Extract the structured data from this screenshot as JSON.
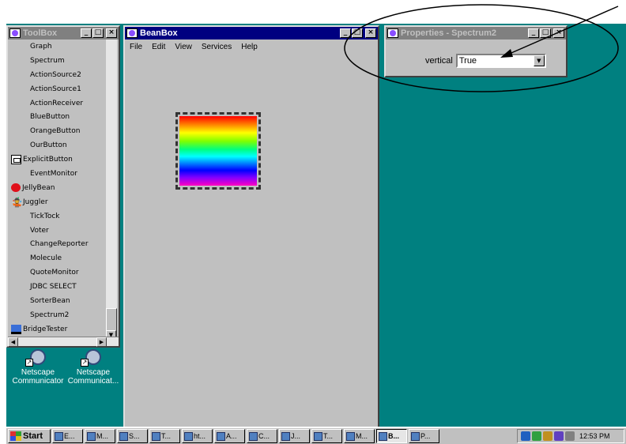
{
  "toolbox": {
    "title": "ToolBox",
    "items": [
      {
        "label": "Graph",
        "icon": ""
      },
      {
        "label": "Spectrum",
        "icon": ""
      },
      {
        "label": "ActionSource2",
        "icon": ""
      },
      {
        "label": "ActionSource1",
        "icon": ""
      },
      {
        "label": "ActionReceiver",
        "icon": ""
      },
      {
        "label": "BlueButton",
        "icon": ""
      },
      {
        "label": "OrangeButton",
        "icon": ""
      },
      {
        "label": "OurButton",
        "icon": ""
      },
      {
        "label": "ExplicitButton",
        "icon": "button-icon"
      },
      {
        "label": "EventMonitor",
        "icon": ""
      },
      {
        "label": "JellyBean",
        "icon": "jellybean-icon"
      },
      {
        "label": "Juggler",
        "icon": "juggler-icon"
      },
      {
        "label": "TickTock",
        "icon": ""
      },
      {
        "label": "Voter",
        "icon": ""
      },
      {
        "label": "ChangeReporter",
        "icon": ""
      },
      {
        "label": "Molecule",
        "icon": ""
      },
      {
        "label": "QuoteMonitor",
        "icon": ""
      },
      {
        "label": "JDBC SELECT",
        "icon": ""
      },
      {
        "label": "SorterBean",
        "icon": ""
      },
      {
        "label": "Spectrum2",
        "icon": ""
      },
      {
        "label": "BridgeTester",
        "icon": "bridge-icon"
      }
    ]
  },
  "beanbox": {
    "title": "BeanBox",
    "menu": [
      "File",
      "Edit",
      "View",
      "Services",
      "Help"
    ]
  },
  "properties": {
    "title": "Properties - Spectrum2",
    "field_label": "vertical",
    "field_value": "True"
  },
  "desktop_icons": [
    {
      "label_line1": "Netscape",
      "label_line2": "Communicator"
    },
    {
      "label_line1": "Netscape",
      "label_line2": "Communicat..."
    }
  ],
  "taskbar": {
    "start_label": "Start",
    "tasks": [
      {
        "label": "E...",
        "icon": "explorer-icon"
      },
      {
        "label": "M...",
        "icon": "word-icon"
      },
      {
        "label": "S...",
        "icon": "netscape-icon"
      },
      {
        "label": "T...",
        "icon": "netscape-icon"
      },
      {
        "label": "ht...",
        "icon": "netscape-icon"
      },
      {
        "label": "A...",
        "icon": "acrobat-icon"
      },
      {
        "label": "C...",
        "icon": "netscape-icon"
      },
      {
        "label": "J...",
        "icon": "java-icon"
      },
      {
        "label": "T...",
        "icon": "java-icon"
      },
      {
        "label": "M...",
        "icon": "java-icon"
      },
      {
        "label": "B...",
        "icon": "java-icon"
      },
      {
        "label": "P...",
        "icon": "java-icon"
      }
    ],
    "active_task_index": 10,
    "clock": "12:53 PM"
  },
  "colors": {
    "desktop": "#008080",
    "active_title": "#000080",
    "inactive_title": "#808080"
  }
}
